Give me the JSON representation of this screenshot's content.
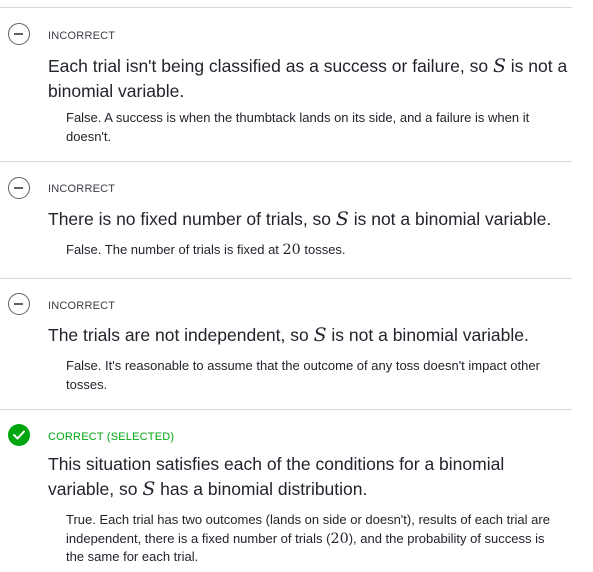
{
  "colors": {
    "correct": "#00a60e",
    "neutral": "#5f6167",
    "divider": "#d6d8da"
  },
  "choices": [
    {
      "status": "INCORRECT",
      "icon": "minus-circle-icon",
      "text_a": "Each trial isn't being classified as a success or failure, so ",
      "var": "S",
      "text_b": " is not a binomial variable.",
      "rationale": "False. A success is when the thumbtack lands on its side, and a failure is when it doesn't."
    },
    {
      "status": "INCORRECT",
      "icon": "minus-circle-icon",
      "text_a": "There is no fixed number of trials, so ",
      "var": "S",
      "text_b": " is not a binomial variable.",
      "rationale_a": "False. The number of trials is fixed at ",
      "rationale_num": "20",
      "rationale_b": " tosses."
    },
    {
      "status": "INCORRECT",
      "icon": "minus-circle-icon",
      "text_a": "The trials are not independent, so ",
      "var": "S",
      "text_b": " is not a binomial variable.",
      "rationale": "False. It's reasonable to assume that the outcome of any toss doesn't impact other tosses."
    },
    {
      "status": "CORRECT (SELECTED)",
      "icon": "check-circle-icon",
      "text_a": "This situation satisfies each of the conditions for a binomial variable, so ",
      "var": "S",
      "text_b": " has a binomial distribution.",
      "rationale_a": "True. Each trial has two outcomes (lands on side or doesn't), results of each trial are independent, there is a fixed number of trials (",
      "rationale_num": "20",
      "rationale_b": "), and the probability of success is the same for each trial."
    }
  ]
}
